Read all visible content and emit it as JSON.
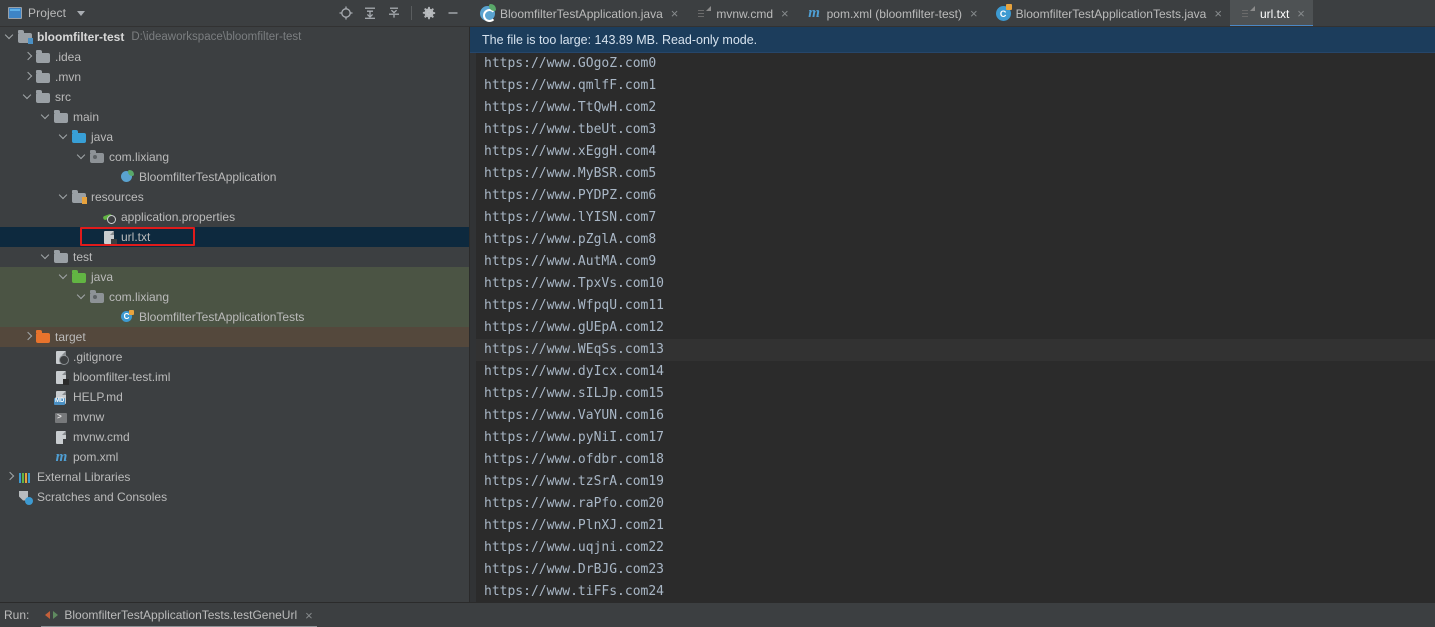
{
  "project_panel": {
    "title": "Project",
    "window_icon": "project-window-icon",
    "dropdown_icon": "chevron-down-icon",
    "tools": [
      {
        "name": "locate-icon",
        "glyph": "locate"
      },
      {
        "name": "expand-all-icon",
        "glyph": "expand"
      },
      {
        "name": "collapse-all-icon",
        "glyph": "collapse"
      },
      {
        "name": "settings-gear-icon",
        "glyph": "gear"
      },
      {
        "name": "hide-panel-icon",
        "glyph": "minus"
      }
    ]
  },
  "tree": [
    {
      "label": "bloomfilter-test",
      "path": "D:\\ideaworkspace\\bloomfilter-test",
      "indent": 0,
      "arrow": "down",
      "icon": "folder-module",
      "bold": true,
      "state": "normal"
    },
    {
      "label": ".idea",
      "indent": 1,
      "arrow": "right",
      "icon": "folder-gray",
      "state": "normal"
    },
    {
      "label": ".mvn",
      "indent": 1,
      "arrow": "right",
      "icon": "folder-gray",
      "state": "normal"
    },
    {
      "label": "src",
      "indent": 1,
      "arrow": "down",
      "icon": "folder-gray",
      "state": "normal"
    },
    {
      "label": "main",
      "indent": 2,
      "arrow": "down",
      "icon": "folder-gray",
      "state": "normal"
    },
    {
      "label": "java",
      "indent": 3,
      "arrow": "down",
      "icon": "folder-blue",
      "state": "normal"
    },
    {
      "label": "com.lixiang",
      "indent": 4,
      "arrow": "down",
      "icon": "folder-package",
      "state": "normal"
    },
    {
      "label": "BloomfilterTestApplication",
      "indent": 5,
      "arrow": "none",
      "icon": "spring-app",
      "state": "normal"
    },
    {
      "label": "resources",
      "indent": 3,
      "arrow": "down",
      "icon": "folder-resources",
      "state": "normal"
    },
    {
      "label": "application.properties",
      "indent": 4,
      "arrow": "none",
      "icon": "properties-file",
      "state": "normal"
    },
    {
      "label": "url.txt",
      "indent": 4,
      "arrow": "none",
      "icon": "text-file",
      "state": "selected",
      "annotated": true
    },
    {
      "label": "test",
      "indent": 2,
      "arrow": "down",
      "icon": "folder-gray",
      "state": "normal"
    },
    {
      "label": "java",
      "indent": 3,
      "arrow": "down",
      "icon": "folder-green",
      "state": "tint-green"
    },
    {
      "label": "com.lixiang",
      "indent": 4,
      "arrow": "down",
      "icon": "folder-package",
      "state": "tint-green"
    },
    {
      "label": "BloomfilterTestApplicationTests",
      "indent": 5,
      "arrow": "none",
      "icon": "test-class",
      "state": "tint-green"
    },
    {
      "label": "target",
      "indent": 1,
      "arrow": "right",
      "icon": "folder-orange",
      "state": "tint-brown"
    },
    {
      "label": ".gitignore",
      "indent": 2,
      "arrow": "none",
      "icon": "gitignore-file",
      "state": "normal"
    },
    {
      "label": "bloomfilter-test.iml",
      "indent": 2,
      "arrow": "none",
      "icon": "iml-file",
      "state": "normal"
    },
    {
      "label": "HELP.md",
      "indent": 2,
      "arrow": "none",
      "icon": "markdown-file",
      "state": "normal"
    },
    {
      "label": "mvnw",
      "indent": 2,
      "arrow": "none",
      "icon": "shell-file",
      "state": "normal"
    },
    {
      "label": "mvnw.cmd",
      "indent": 2,
      "arrow": "none",
      "icon": "text-file",
      "state": "normal"
    },
    {
      "label": "pom.xml",
      "indent": 2,
      "arrow": "none",
      "icon": "maven-file",
      "state": "normal"
    },
    {
      "label": "External Libraries",
      "indent": 0,
      "arrow": "right",
      "icon": "libraries",
      "state": "normal"
    },
    {
      "label": "Scratches and Consoles",
      "indent": 0,
      "arrow": "none",
      "icon": "scratches",
      "state": "normal"
    }
  ],
  "editor_tabs": [
    {
      "label": "BloomfilterTestApplication.java",
      "icon": "spring-app",
      "active": false,
      "close": "×"
    },
    {
      "label": "mvnw.cmd",
      "icon": "text-file",
      "active": false,
      "close": "×"
    },
    {
      "label": "pom.xml (bloomfilter-test)",
      "icon": "maven-file",
      "active": false,
      "close": "×"
    },
    {
      "label": "BloomfilterTestApplicationTests.java",
      "icon": "test-class",
      "active": false,
      "close": "×"
    },
    {
      "label": "url.txt",
      "icon": "text-file",
      "active": true,
      "close": "×"
    }
  ],
  "editor": {
    "warning": "The file is too large: 143.89 MB. Read-only mode.",
    "caret_line_index": 13,
    "lines": [
      "https://www.GOgoZ.com0",
      "https://www.qmlfF.com1",
      "https://www.TtQwH.com2",
      "https://www.tbeUt.com3",
      "https://www.xEggH.com4",
      "https://www.MyBSR.com5",
      "https://www.PYDPZ.com6",
      "https://www.lYISN.com7",
      "https://www.pZglA.com8",
      "https://www.AutMA.com9",
      "https://www.TpxVs.com10",
      "https://www.WfpqU.com11",
      "https://www.gUEpA.com12",
      "https://www.WEqSs.com13",
      "https://www.dyIcx.com14",
      "https://www.sILJp.com15",
      "https://www.VaYUN.com16",
      "https://www.pyNiI.com17",
      "https://www.ofdbr.com18",
      "https://www.tzSrA.com19",
      "https://www.raPfo.com20",
      "https://www.PlnXJ.com21",
      "https://www.uqjni.com22",
      "https://www.DrBJG.com23",
      "https://www.tiFFs.com24"
    ]
  },
  "run_bar": {
    "label": "Run:",
    "tab_label": "BloomfilterTestApplicationTests.testGeneUrl",
    "rerun_icon": "rerun-icon",
    "close": "×"
  },
  "colors": {
    "panel_bg": "#3c3f41",
    "editor_bg": "#2b2b2b",
    "selection_bg": "#0d293e",
    "warning_bg": "#1c3d5c",
    "accent_blue": "#4a88c7",
    "annotation_red": "#e01b1b",
    "code_fg": "#a9b7c6",
    "test_tint": "#4b5444",
    "target_tint": "#54483c"
  }
}
